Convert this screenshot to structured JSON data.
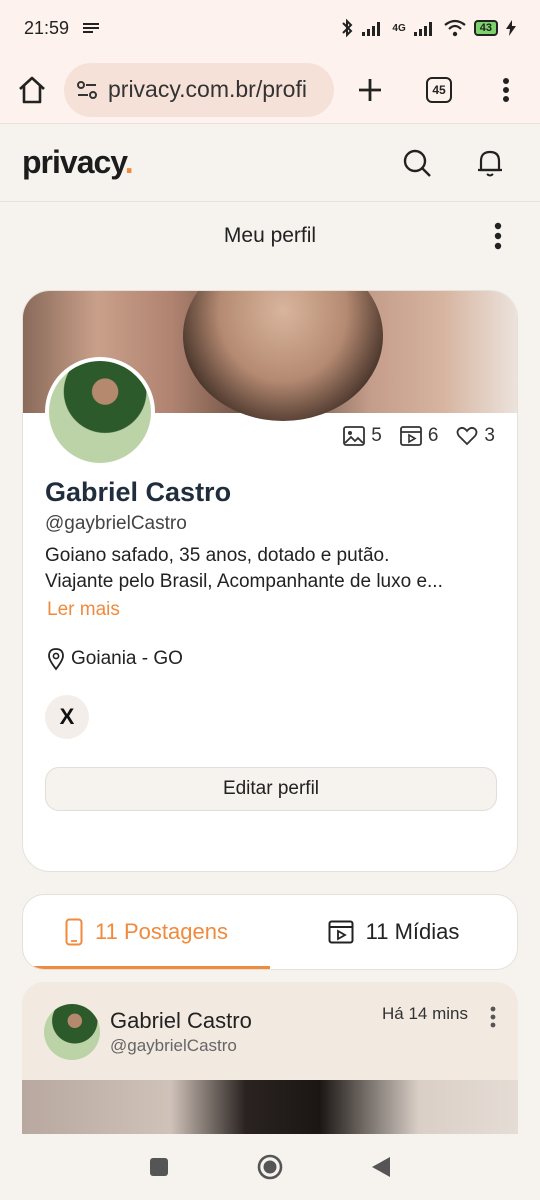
{
  "status": {
    "time": "21:59",
    "network": "4G",
    "battery": "43"
  },
  "browser": {
    "url": "privacy.com.br/profi",
    "tab_count": "45"
  },
  "site": {
    "logo_text": "privacy",
    "logo_dot": ".",
    "accent_color": "#f08a3c"
  },
  "page": {
    "title": "Meu perfil"
  },
  "profile": {
    "name": "Gabriel Castro",
    "handle": "@gaybrielCastro",
    "bio_line1": "Goiano safado, 35 anos, dotado e putão.",
    "bio_line2": "Viajante pelo Brasil, Acompanhante de luxo e...",
    "read_more": "Ler mais",
    "location": "Goiania - GO",
    "stats": {
      "images": "5",
      "videos": "6",
      "likes": "3"
    },
    "social_x": "X",
    "edit_button": "Editar perfil"
  },
  "tabs": [
    {
      "label": "11 Postagens",
      "active": true
    },
    {
      "label": "11 Mídias",
      "active": false
    }
  ],
  "post": {
    "author": "Gabriel Castro",
    "handle": "@gaybrielCastro",
    "time": "Há 14 mins"
  }
}
